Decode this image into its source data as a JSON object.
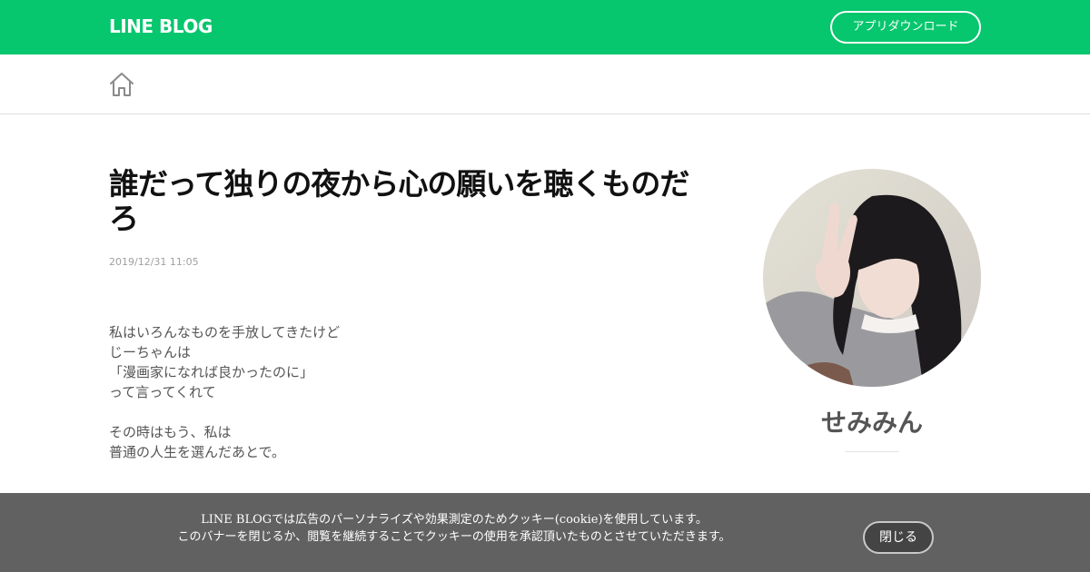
{
  "header": {
    "logo": "LINE BLOG",
    "app_download": "アプリダウンロード",
    "brand_color": "#06c66e"
  },
  "subnav": {
    "home_icon": "home-icon"
  },
  "article": {
    "title": "誰だって独りの夜から心の願いを聴くものだろ",
    "date": "2019/12/31 11:05",
    "body": [
      "私はいろんなものを手放してきたけど",
      "じーちゃんは",
      "「漫画家になれば良かったのに」",
      "って言ってくれて",
      "",
      "その時はもう、私は",
      "普通の人生を選んだあとで。"
    ]
  },
  "profile": {
    "name": "せみみん"
  },
  "cookie": {
    "lines": [
      "LINE BLOGでは広告のパーソナライズや効果測定のためクッキー(cookie)を使用しています。",
      "このバナーを閉じるか、閲覧を継続することでクッキーの使用を承認頂いたものとさせていただきます。"
    ],
    "close_label": "閉じる"
  }
}
